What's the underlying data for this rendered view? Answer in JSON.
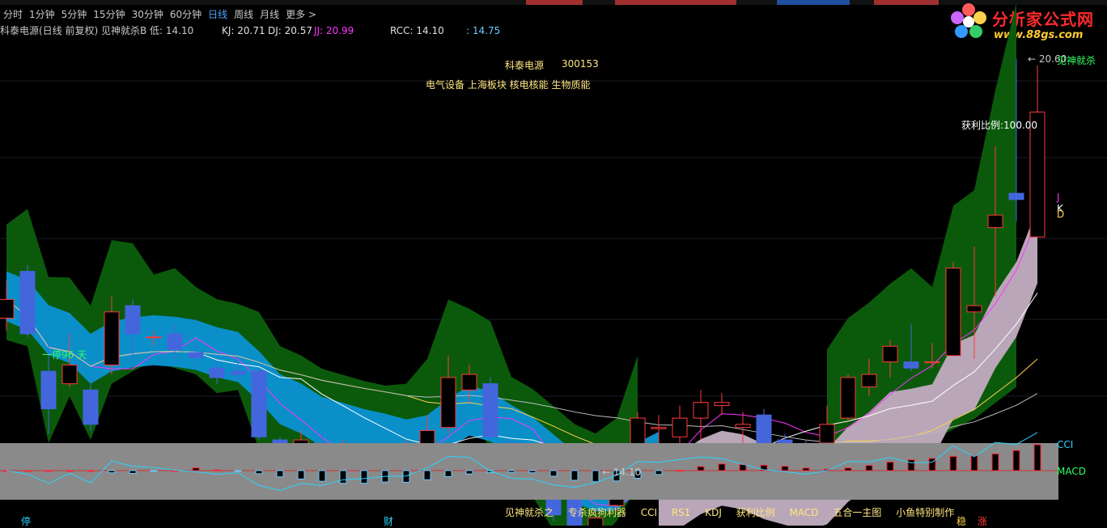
{
  "periods": [
    "分时",
    "1分钟",
    "5分钟",
    "15分钟",
    "30分钟",
    "60分钟",
    "日线",
    "周线",
    "月线",
    "更多 >"
  ],
  "active_period": "日线",
  "indicator_header": {
    "main": "科泰电源(日线 前复权) 见神就杀B  低: 14.10",
    "kj": "KJ: 20.71",
    "dj": "DJ: 20.57",
    "jj": "JJ: 20.99",
    "rcc": "RCC: 14.10",
    "extra": ": 14.75"
  },
  "logo": {
    "title": "分析家公式网",
    "url": "www.88gs.com"
  },
  "stock": {
    "name": "科泰电源",
    "code": "300153",
    "sectors": "电气设备 上海板块 核电核能 生物质能"
  },
  "labels": {
    "profit_ratio": "获利比例:100.00",
    "days_label": "一停96 天",
    "low_label": "← 14.10",
    "high_label": "← 20.60",
    "strategy": "见神就杀",
    "line_j": "J",
    "line_k": "K",
    "line_d": "D",
    "cci": "CCI",
    "macd": "MACD",
    "mark_stop": "停",
    "mark_cai": "财",
    "mark_wen": "稳",
    "mark_zhang": "涨"
  },
  "bottom_menu": [
    "见神就杀之",
    "专杀疯狗利器",
    "CCI",
    "RS1",
    "KDJ",
    "获利比例",
    "MACD",
    "五合一主图",
    "小鱼特别制作"
  ],
  "colors": {
    "up": "#ff3b3b",
    "down": "#4466dd",
    "green_band": "#0b5a0b",
    "blue_band": "#0a8fc9",
    "pink_band": "#b9a6b8",
    "yellow": "#ffd24d",
    "magenta": "#ff33ff",
    "white": "#ffffff",
    "cci": "#2ad4ff",
    "macd_up": "#ff2233",
    "macd_down": "#66ccff",
    "panel": "#8a8a8a"
  },
  "chart_data": {
    "type": "candlestick",
    "price_axis": [
      14.1,
      20.6
    ],
    "candles": [
      [
        16.45,
        16.75,
        17.05,
        16.25
      ],
      [
        17.2,
        16.2,
        17.3,
        16.15
      ],
      [
        15.6,
        15.0,
        16.05,
        14.6
      ],
      [
        15.4,
        15.7,
        16.2,
        15.35
      ],
      [
        15.3,
        14.75,
        15.5,
        14.65
      ],
      [
        15.7,
        16.55,
        16.8,
        15.55
      ],
      [
        16.65,
        16.2,
        16.75,
        15.75
      ],
      [
        16.15,
        16.15,
        16.25,
        16.0
      ],
      [
        16.2,
        15.95,
        16.35,
        15.8
      ],
      [
        15.9,
        15.82,
        16.05,
        15.7
      ],
      [
        15.65,
        15.5,
        15.75,
        15.4
      ],
      [
        15.6,
        15.55,
        15.75,
        15.45
      ],
      [
        15.6,
        14.55,
        15.65,
        14.5
      ],
      [
        14.5,
        14.0,
        14.55,
        13.95
      ],
      [
        14.05,
        14.5,
        14.65,
        13.7
      ],
      [
        14.45,
        14.1,
        14.6,
        14.05
      ],
      [
        14.15,
        14.35,
        14.5,
        14.1
      ],
      [
        14.28,
        14.25,
        14.42,
        14.1
      ],
      [
        14.28,
        14.25,
        14.4,
        14.0
      ],
      [
        14.1,
        14.1,
        14.5,
        13.95
      ],
      [
        14.2,
        14.65,
        14.9,
        14.05
      ],
      [
        14.7,
        15.5,
        15.85,
        14.6
      ],
      [
        15.3,
        15.55,
        15.7,
        15.1
      ],
      [
        15.4,
        14.55,
        15.5,
        14.5
      ],
      [
        14.45,
        13.95,
        14.5,
        13.9
      ],
      [
        13.9,
        13.85,
        14.3,
        13.75
      ],
      [
        13.8,
        13.3,
        13.9,
        13.2
      ],
      [
        13.55,
        13.0,
        13.65,
        12.9
      ],
      [
        13.05,
        13.25,
        13.4,
        13.0
      ],
      [
        13.45,
        13.8,
        13.95,
        13.35
      ],
      [
        13.95,
        14.85,
        14.95,
        13.9
      ],
      [
        14.68,
        14.7,
        14.9,
        14.45
      ],
      [
        14.55,
        14.85,
        15.05,
        14.35
      ],
      [
        14.85,
        15.1,
        15.3,
        14.5
      ],
      [
        15.05,
        15.1,
        15.25,
        14.9
      ],
      [
        14.7,
        14.75,
        14.95,
        14.35
      ],
      [
        14.9,
        14.45,
        15.0,
        14.2
      ],
      [
        14.5,
        14.45,
        14.6,
        13.9
      ],
      [
        14.38,
        14.36,
        14.5,
        14.25
      ],
      [
        14.45,
        14.75,
        15.05,
        14.4
      ],
      [
        14.85,
        15.5,
        15.55,
        14.8
      ],
      [
        15.35,
        15.55,
        15.8,
        15.2
      ],
      [
        15.75,
        16.0,
        16.1,
        15.5
      ],
      [
        15.75,
        15.65,
        16.35,
        15.6
      ],
      [
        15.75,
        15.75,
        16.05,
        15.65
      ],
      [
        15.85,
        17.25,
        17.35,
        15.85
      ],
      [
        16.55,
        16.65,
        17.6,
        15.8
      ],
      [
        17.9,
        18.1,
        19.2,
        16.8
      ],
      [
        18.45,
        18.35,
        20.6,
        18.0
      ],
      [
        17.75,
        19.75,
        20.5,
        17.75
      ]
    ]
  }
}
